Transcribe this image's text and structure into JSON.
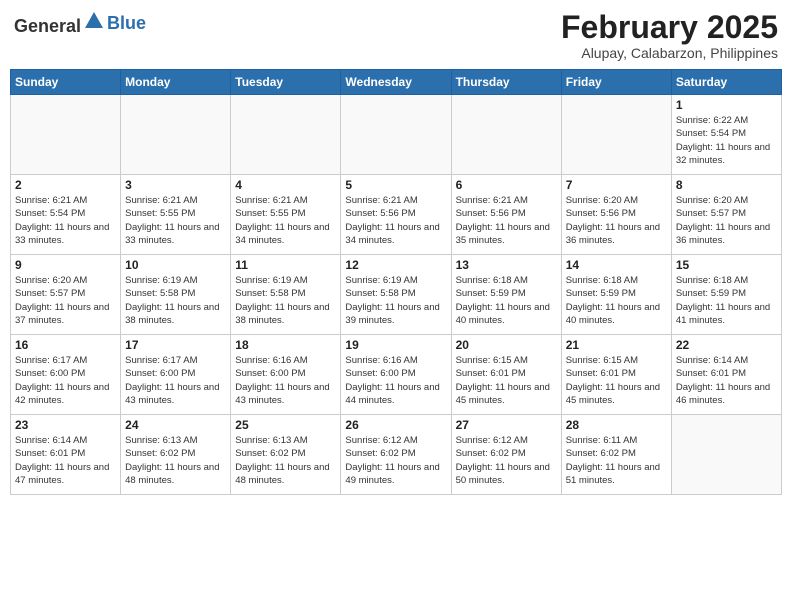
{
  "header": {
    "logo_general": "General",
    "logo_blue": "Blue",
    "month_title": "February 2025",
    "subtitle": "Alupay, Calabarzon, Philippines"
  },
  "weekdays": [
    "Sunday",
    "Monday",
    "Tuesday",
    "Wednesday",
    "Thursday",
    "Friday",
    "Saturday"
  ],
  "weeks": [
    [
      {
        "day": "",
        "info": ""
      },
      {
        "day": "",
        "info": ""
      },
      {
        "day": "",
        "info": ""
      },
      {
        "day": "",
        "info": ""
      },
      {
        "day": "",
        "info": ""
      },
      {
        "day": "",
        "info": ""
      },
      {
        "day": "1",
        "info": "Sunrise: 6:22 AM\nSunset: 5:54 PM\nDaylight: 11 hours and 32 minutes."
      }
    ],
    [
      {
        "day": "2",
        "info": "Sunrise: 6:21 AM\nSunset: 5:54 PM\nDaylight: 11 hours and 33 minutes."
      },
      {
        "day": "3",
        "info": "Sunrise: 6:21 AM\nSunset: 5:55 PM\nDaylight: 11 hours and 33 minutes."
      },
      {
        "day": "4",
        "info": "Sunrise: 6:21 AM\nSunset: 5:55 PM\nDaylight: 11 hours and 34 minutes."
      },
      {
        "day": "5",
        "info": "Sunrise: 6:21 AM\nSunset: 5:56 PM\nDaylight: 11 hours and 34 minutes."
      },
      {
        "day": "6",
        "info": "Sunrise: 6:21 AM\nSunset: 5:56 PM\nDaylight: 11 hours and 35 minutes."
      },
      {
        "day": "7",
        "info": "Sunrise: 6:20 AM\nSunset: 5:56 PM\nDaylight: 11 hours and 36 minutes."
      },
      {
        "day": "8",
        "info": "Sunrise: 6:20 AM\nSunset: 5:57 PM\nDaylight: 11 hours and 36 minutes."
      }
    ],
    [
      {
        "day": "9",
        "info": "Sunrise: 6:20 AM\nSunset: 5:57 PM\nDaylight: 11 hours and 37 minutes."
      },
      {
        "day": "10",
        "info": "Sunrise: 6:19 AM\nSunset: 5:58 PM\nDaylight: 11 hours and 38 minutes."
      },
      {
        "day": "11",
        "info": "Sunrise: 6:19 AM\nSunset: 5:58 PM\nDaylight: 11 hours and 38 minutes."
      },
      {
        "day": "12",
        "info": "Sunrise: 6:19 AM\nSunset: 5:58 PM\nDaylight: 11 hours and 39 minutes."
      },
      {
        "day": "13",
        "info": "Sunrise: 6:18 AM\nSunset: 5:59 PM\nDaylight: 11 hours and 40 minutes."
      },
      {
        "day": "14",
        "info": "Sunrise: 6:18 AM\nSunset: 5:59 PM\nDaylight: 11 hours and 40 minutes."
      },
      {
        "day": "15",
        "info": "Sunrise: 6:18 AM\nSunset: 5:59 PM\nDaylight: 11 hours and 41 minutes."
      }
    ],
    [
      {
        "day": "16",
        "info": "Sunrise: 6:17 AM\nSunset: 6:00 PM\nDaylight: 11 hours and 42 minutes."
      },
      {
        "day": "17",
        "info": "Sunrise: 6:17 AM\nSunset: 6:00 PM\nDaylight: 11 hours and 43 minutes."
      },
      {
        "day": "18",
        "info": "Sunrise: 6:16 AM\nSunset: 6:00 PM\nDaylight: 11 hours and 43 minutes."
      },
      {
        "day": "19",
        "info": "Sunrise: 6:16 AM\nSunset: 6:00 PM\nDaylight: 11 hours and 44 minutes."
      },
      {
        "day": "20",
        "info": "Sunrise: 6:15 AM\nSunset: 6:01 PM\nDaylight: 11 hours and 45 minutes."
      },
      {
        "day": "21",
        "info": "Sunrise: 6:15 AM\nSunset: 6:01 PM\nDaylight: 11 hours and 45 minutes."
      },
      {
        "day": "22",
        "info": "Sunrise: 6:14 AM\nSunset: 6:01 PM\nDaylight: 11 hours and 46 minutes."
      }
    ],
    [
      {
        "day": "23",
        "info": "Sunrise: 6:14 AM\nSunset: 6:01 PM\nDaylight: 11 hours and 47 minutes."
      },
      {
        "day": "24",
        "info": "Sunrise: 6:13 AM\nSunset: 6:02 PM\nDaylight: 11 hours and 48 minutes."
      },
      {
        "day": "25",
        "info": "Sunrise: 6:13 AM\nSunset: 6:02 PM\nDaylight: 11 hours and 48 minutes."
      },
      {
        "day": "26",
        "info": "Sunrise: 6:12 AM\nSunset: 6:02 PM\nDaylight: 11 hours and 49 minutes."
      },
      {
        "day": "27",
        "info": "Sunrise: 6:12 AM\nSunset: 6:02 PM\nDaylight: 11 hours and 50 minutes."
      },
      {
        "day": "28",
        "info": "Sunrise: 6:11 AM\nSunset: 6:02 PM\nDaylight: 11 hours and 51 minutes."
      },
      {
        "day": "",
        "info": ""
      }
    ]
  ]
}
